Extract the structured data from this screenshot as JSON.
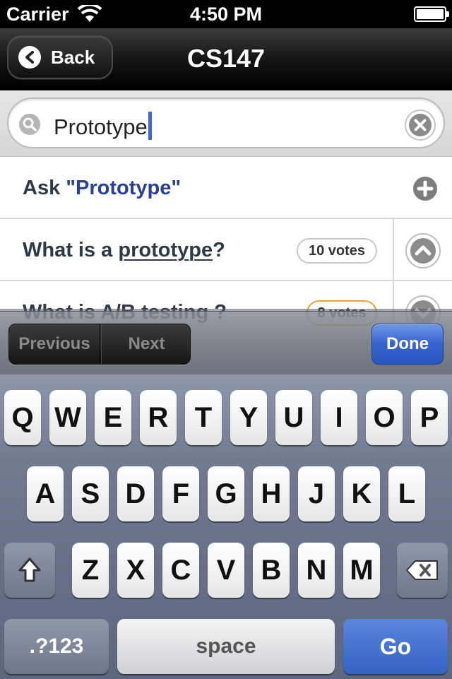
{
  "status_bar": {
    "carrier": "Carrier",
    "time": "4:50 PM"
  },
  "nav": {
    "back_label": "Back",
    "title": "CS147"
  },
  "search": {
    "value": "Prototype"
  },
  "ask_row": {
    "prefix": "Ask ",
    "query": "\"Prototype\""
  },
  "questions": [
    {
      "before": "What is a ",
      "keyword": "prototype",
      "after": "?",
      "votes": "10 votes",
      "vote_direction": "up"
    },
    {
      "before": "What is A/B testing ?",
      "keyword": "",
      "after": "",
      "votes": "8 votes",
      "vote_direction": "down"
    }
  ],
  "accessory": {
    "previous": "Previous",
    "next": "Next",
    "done": "Done"
  },
  "keyboard": {
    "row1": [
      "Q",
      "W",
      "E",
      "R",
      "T",
      "Y",
      "U",
      "I",
      "O",
      "P"
    ],
    "row2": [
      "A",
      "S",
      "D",
      "F",
      "G",
      "H",
      "J",
      "K",
      "L"
    ],
    "row3": [
      "Z",
      "X",
      "C",
      "V",
      "B",
      "N",
      "M"
    ],
    "numbers": ".?123",
    "space": "space",
    "go": "Go"
  },
  "colors": {
    "accent_blue": "#3562c6",
    "query_blue": "#2b3f95",
    "vote_orange": "#f0a030",
    "caret": "#3f66cf"
  },
  "icons": [
    "wifi-icon",
    "battery-icon",
    "back-arrow-icon",
    "search-icon",
    "clear-icon",
    "plus-icon",
    "upvote-icon",
    "downvote-icon",
    "shift-icon",
    "delete-icon"
  ]
}
